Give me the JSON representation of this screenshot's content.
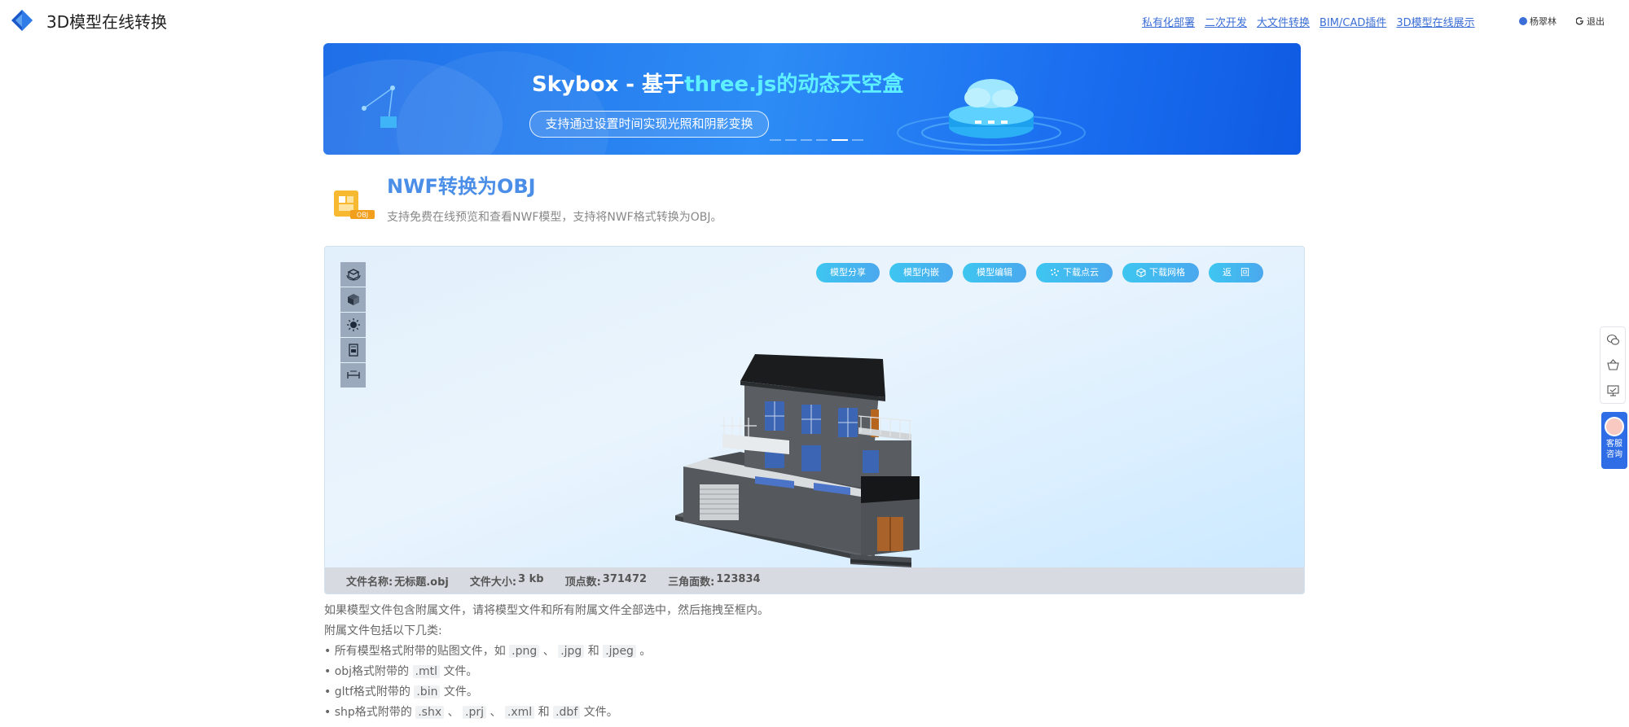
{
  "header": {
    "app_title": "3D模型在线转换",
    "nav_links": [
      "私有化部署",
      "二次开发",
      "大文件转换",
      "BIM/CAD插件",
      "3D模型在线展示"
    ],
    "user_name": "杨翠林",
    "logout_label": "退出"
  },
  "banner": {
    "title_prefix": "Skybox - 基于",
    "title_highlight": "three.js的动态天空盒",
    "subtitle": "支持通过设置时间实现光照和阴影变换",
    "slide_count": 6,
    "active_slide": 5
  },
  "page": {
    "icon_badge": "OBJ",
    "title": "NWF转换为OBJ",
    "subtitle": "支持免费在线预览和查看NWF模型，支持将NWF格式转换为OBJ。"
  },
  "viewer": {
    "tools": [
      "rotate-icon",
      "cube-icon",
      "light-icon",
      "document-icon",
      "measure-icon"
    ],
    "actions": {
      "share": "模型分享",
      "embed": "模型内嵌",
      "edit": "模型编辑",
      "download_points": "下载点云",
      "download_mesh": "下载网格",
      "back": "返　回"
    },
    "info": {
      "file_name_label": "文件名称:",
      "file_name": "无标题.obj",
      "file_size_label": "文件大小:",
      "file_size": "3 kb",
      "vertices_label": "顶点数:",
      "vertices": "371472",
      "faces_label": "三角面数:",
      "faces": "123834"
    }
  },
  "notes": {
    "line1": "如果模型文件包含附属文件，请将模型文件和所有附属文件全部选中，然后拖拽至框内。",
    "line2": "附属文件包括以下几类:",
    "item1_prefix": "• 所有模型格式附带的贴图文件，如",
    "item1_ext1": ".png",
    "item1_sep1": "、",
    "item1_ext2": ".jpg",
    "item1_and": "和",
    "item1_ext3": ".jpeg",
    "item1_end": "。",
    "item2_prefix": "• obj格式附带的",
    "item2_ext": ".mtl",
    "item2_end": "文件。",
    "item3_prefix": "• gltf格式附带的",
    "item3_ext": ".bin",
    "item3_end": "文件。",
    "item4_prefix": "• shp格式附带的",
    "item4_ext1": ".shx",
    "item4_sep1": "、",
    "item4_ext2": ".prj",
    "item4_sep2": "、",
    "item4_ext3": ".xml",
    "item4_and": "和",
    "item4_ext4": ".dbf",
    "item4_end": "文件。"
  },
  "side_tools": [
    "wechat-icon",
    "basket-icon",
    "monitor-icon"
  ],
  "service": {
    "label": "客服咨询"
  },
  "colors": {
    "accent": "#4b8ee8",
    "link": "#3b6ed6",
    "banner": "#1f6fe8",
    "action": "#3ec6f0"
  }
}
